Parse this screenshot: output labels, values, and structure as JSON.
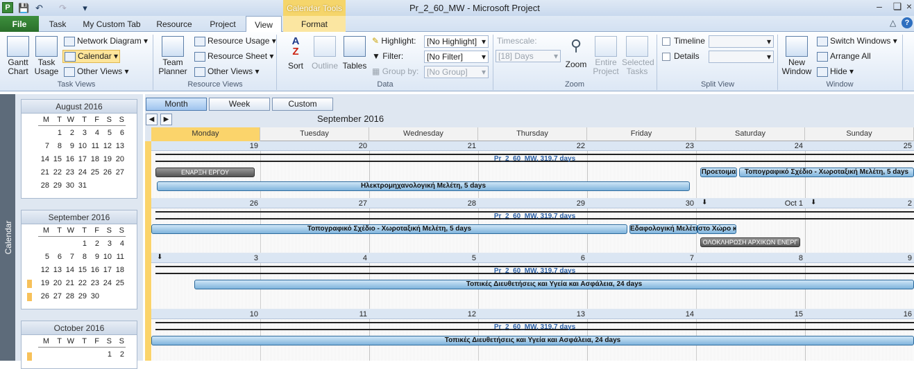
{
  "title": {
    "filename": "Pr_2_60_MW",
    "separator": " - ",
    "app": "Microsoft Project",
    "context_tab": "Calendar Tools"
  },
  "qat": {
    "app_icon": "P"
  },
  "tabs": [
    "File",
    "Task",
    "My Custom Tab",
    "Resource",
    "Project",
    "View",
    "Format"
  ],
  "ribbon": {
    "task_views": {
      "gantt": "Gantt Chart",
      "task_usage": "Task Usage",
      "network": "Network Diagram",
      "calendar": "Calendar",
      "other": "Other Views",
      "label": "Task Views"
    },
    "resource_views": {
      "team": "Team Planner",
      "usage": "Resource Usage",
      "sheet": "Resource Sheet",
      "other": "Other Views",
      "label": "Resource Views"
    },
    "data": {
      "sort": "Sort",
      "outline": "Outline",
      "tables": "Tables",
      "highlight_label": "Highlight:",
      "highlight_value": "[No Highlight]",
      "filter_label": "Filter:",
      "filter_value": "[No Filter]",
      "group_label": "Group by:",
      "group_value": "[No Group]",
      "label": "Data"
    },
    "zoom": {
      "timescale_label": "Timescale:",
      "timescale_value": "[18] Days",
      "zoom": "Zoom",
      "entire": "Entire Project",
      "selected": "Selected Tasks",
      "label": "Zoom"
    },
    "split": {
      "timeline": "Timeline",
      "details": "Details",
      "label": "Split View"
    },
    "window": {
      "new": "New Window",
      "switch": "Switch Windows",
      "arrange": "Arrange All",
      "hide": "Hide",
      "label": "Window"
    }
  },
  "sidebar": {
    "label": "Calendar"
  },
  "mini_calendars": [
    {
      "month": "August 2016",
      "dow": [
        "M",
        "T",
        "W",
        "T",
        "F",
        "S",
        "S"
      ],
      "days": [
        "",
        "1",
        "2",
        "3",
        "4",
        "5",
        "6",
        "7",
        "8",
        "9",
        "10",
        "11",
        "12",
        "13",
        "14",
        "15",
        "16",
        "17",
        "18",
        "19",
        "20",
        "21",
        "22",
        "23",
        "24",
        "25",
        "26",
        "27",
        "28",
        "29",
        "30",
        "31",
        "",
        "",
        "",
        ""
      ]
    },
    {
      "month": "September 2016",
      "dow": [
        "M",
        "T",
        "W",
        "T",
        "F",
        "S",
        "S"
      ],
      "days": [
        "",
        "",
        "",
        "1",
        "2",
        "3",
        "4",
        "5",
        "6",
        "7",
        "8",
        "9",
        "10",
        "11",
        "12",
        "13",
        "14",
        "15",
        "16",
        "17",
        "18",
        "19",
        "20",
        "21",
        "22",
        "23",
        "24",
        "25",
        "26",
        "27",
        "28",
        "29",
        "30",
        "",
        ""
      ]
    },
    {
      "month": "October 2016",
      "dow": [
        "M",
        "T",
        "W",
        "T",
        "F",
        "S",
        "S"
      ],
      "days": [
        "",
        "",
        "",
        "",
        "",
        "1",
        "2"
      ]
    }
  ],
  "calendar": {
    "view_buttons": {
      "month": "Month",
      "week": "Week",
      "custom": "Custom"
    },
    "current_month": "September 2016",
    "days": [
      "Monday",
      "Tuesday",
      "Wednesday",
      "Thursday",
      "Friday",
      "Saturday",
      "Sunday"
    ],
    "weeks": [
      {
        "dates": [
          "19",
          "20",
          "21",
          "22",
          "23",
          "24",
          "25"
        ],
        "project": "Pr_2_60_MW, 319.7 days"
      },
      {
        "dates": [
          "26",
          "27",
          "28",
          "29",
          "30",
          "Oct 1",
          "2"
        ],
        "project": "Pr_2_60_MW, 319.7 days"
      },
      {
        "dates": [
          "3",
          "4",
          "5",
          "6",
          "7",
          "8",
          "9"
        ],
        "project": "Pr_2_60_MW, 319.7 days"
      },
      {
        "dates": [
          "10",
          "11",
          "12",
          "13",
          "14",
          "15",
          "16"
        ],
        "project": "Pr_2_60_MW, 319.7 days"
      }
    ],
    "tasks": {
      "w1_milestone": "ΕΝΑΡΞΗ ΕΡΓΟΥ",
      "w1_prostoma": "Προετοιμα",
      "w1_topo": "Τοπογραφικό Σχέδιο - Χωροταξική Μελέτη, 5 days",
      "w1_ilektro": "Ηλεκτρομηχανολογική Μελέτη, 5 days",
      "w2_topo": "Τοπογραφικό Σχέδιο - Χωροταξική Μελέτη, 5 days",
      "w2_edafo": "Εδαφολογική Μελέτη",
      "w2_xoro": "στο Χώρο κ",
      "w2_milestone": "ΟΛΟΚΛΗΡΩΣΗ ΑΡΧΙΚΩΝ ΕΝΕΡΓ",
      "w3_topikes": "Τοπικές Διευθετήσεις και Υγεία και Ασφάλεια, 24 days",
      "w4_topikes": "Τοπικές Διευθετήσεις και Υγεία και Ασφάλεια, 24 days"
    }
  },
  "colors": {
    "accent": "#fbd46b",
    "file_tab": "#2a6f2a",
    "task_bar": "#7fb4dc",
    "project_text": "#2a5fa6"
  }
}
